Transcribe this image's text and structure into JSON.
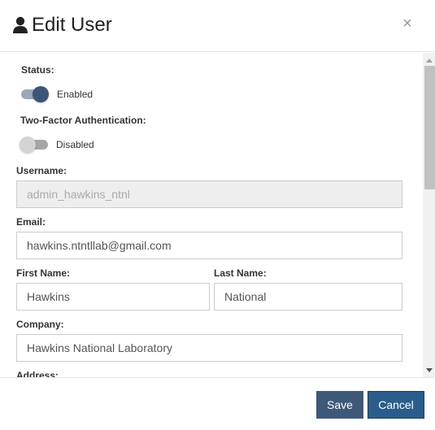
{
  "header": {
    "icon": "user-icon",
    "title": "Edit User",
    "close_icon": "close-icon",
    "close_label": "×"
  },
  "form": {
    "status": {
      "label": "Status:",
      "toggle_state": "on",
      "toggle_text": "Enabled"
    },
    "two_factor": {
      "label": "Two-Factor Authentication:",
      "toggle_state": "off",
      "toggle_text": "Disabled"
    },
    "username": {
      "label": "Username:",
      "value": "admin_hawkins_ntnl",
      "disabled": true
    },
    "email": {
      "label": "Email:",
      "value": "hawkins.ntntllab@gmail.com"
    },
    "first_name": {
      "label": "First Name:",
      "value": "Hawkins"
    },
    "last_name": {
      "label": "Last Name:",
      "value": "National"
    },
    "company": {
      "label": "Company:",
      "value": "Hawkins National Laboratory"
    },
    "address": {
      "label": "Address:"
    }
  },
  "footer": {
    "save_label": "Save",
    "cancel_label": "Cancel"
  },
  "colors": {
    "primary": "#3e5878",
    "cancel": "#2a5d8c",
    "toggle_on": "#3b5677"
  }
}
